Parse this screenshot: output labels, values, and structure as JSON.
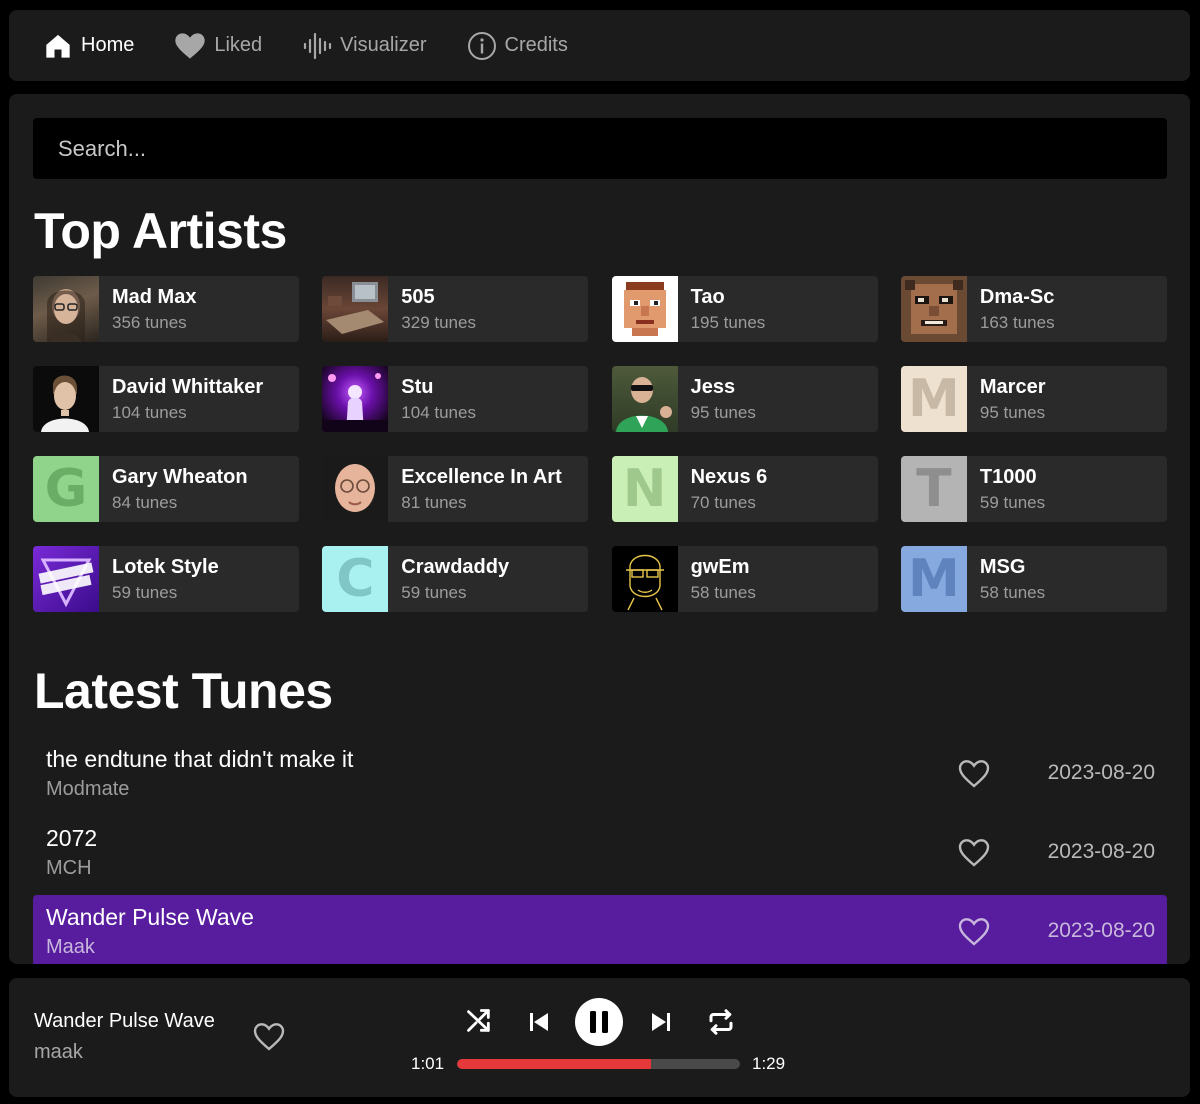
{
  "nav": {
    "items": [
      {
        "label": "Home",
        "icon": "home-icon",
        "active": true
      },
      {
        "label": "Liked",
        "icon": "heart-icon",
        "active": false
      },
      {
        "label": "Visualizer",
        "icon": "waveform-icon",
        "active": false
      },
      {
        "label": "Credits",
        "icon": "info-icon",
        "active": false
      }
    ]
  },
  "search": {
    "placeholder": "Search..."
  },
  "top_artists": {
    "heading": "Top Artists",
    "items": [
      {
        "name": "Mad Max",
        "count": "356 tunes",
        "avatar": "photo"
      },
      {
        "name": "505",
        "count": "329 tunes",
        "avatar": "photo"
      },
      {
        "name": "Tao",
        "count": "195 tunes",
        "avatar": "pixel-face"
      },
      {
        "name": "Dma-Sc",
        "count": "163 tunes",
        "avatar": "pixel-face"
      },
      {
        "name": "David Whittaker",
        "count": "104 tunes",
        "avatar": "photo"
      },
      {
        "name": "Stu",
        "count": "104 tunes",
        "avatar": "photo"
      },
      {
        "name": "Jess",
        "count": "95 tunes",
        "avatar": "photo"
      },
      {
        "name": "Marcer",
        "count": "95 tunes",
        "avatar": "letter",
        "letter": "M",
        "color": "#efe1cf"
      },
      {
        "name": "Gary Wheaton",
        "count": "84 tunes",
        "avatar": "letter",
        "letter": "G",
        "color": "#8fd48a"
      },
      {
        "name": "Excellence In Art",
        "count": "81 tunes",
        "avatar": "photo"
      },
      {
        "name": "Nexus 6",
        "count": "70 tunes",
        "avatar": "letter",
        "letter": "N",
        "color": "#c9efb6"
      },
      {
        "name": "T1000",
        "count": "59 tunes",
        "avatar": "letter",
        "letter": "T",
        "color": "#b4b4b4"
      },
      {
        "name": "Lotek Style",
        "count": "59 tunes",
        "avatar": "logo"
      },
      {
        "name": "Crawdaddy",
        "count": "59 tunes",
        "avatar": "letter",
        "letter": "C",
        "color": "#a9f0f0"
      },
      {
        "name": "gwEm",
        "count": "58 tunes",
        "avatar": "line-art"
      },
      {
        "name": "MSG",
        "count": "58 tunes",
        "avatar": "letter",
        "letter": "M",
        "color": "#86a9e0"
      }
    ]
  },
  "latest_tunes": {
    "heading": "Latest Tunes",
    "items": [
      {
        "title": "the endtune that didn't make it",
        "artist": "Modmate",
        "date": "2023-08-20",
        "playing": false
      },
      {
        "title": "2072",
        "artist": "MCH",
        "date": "2023-08-20",
        "playing": false
      },
      {
        "title": "Wander Pulse Wave",
        "artist": "Maak",
        "date": "2023-08-20",
        "playing": true
      }
    ]
  },
  "player": {
    "title": "Wander Pulse Wave",
    "artist": "maak",
    "current_time": "1:01",
    "total_time": "1:29",
    "progress": 0.685,
    "state": "playing",
    "accent": "#e5383b"
  },
  "colors": {
    "panel": "#1b1b1b",
    "card": "#2a2a2a",
    "playing_row": "#581c9e",
    "progress_fill": "#e5383b"
  }
}
